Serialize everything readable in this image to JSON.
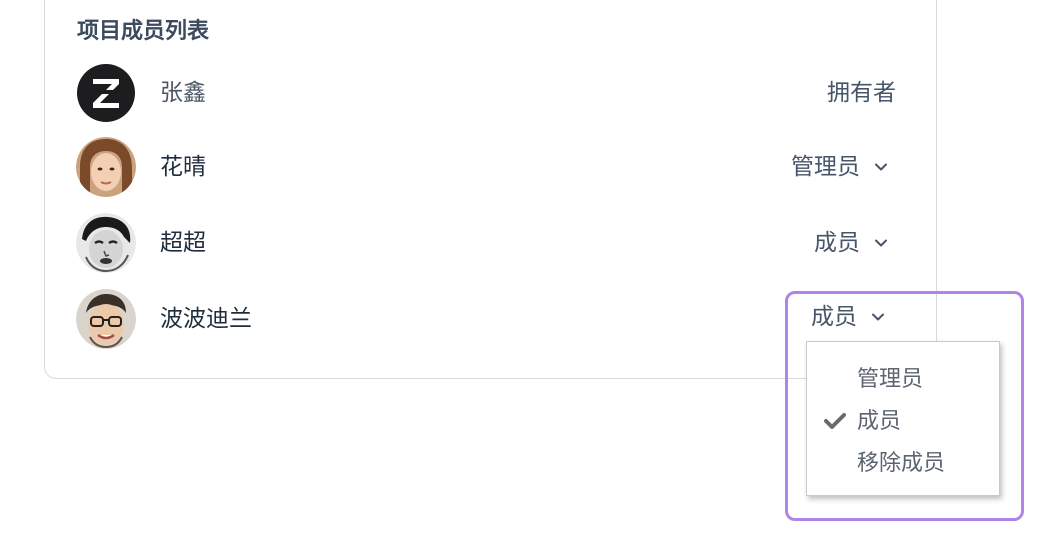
{
  "card": {
    "title": "项目成员列表"
  },
  "members": [
    {
      "name": "张鑫",
      "role": "拥有者",
      "editable": false,
      "avatar": "z-logo-avatar"
    },
    {
      "name": "花晴",
      "role": "管理员",
      "editable": true,
      "avatar": "photo-avatar-woman"
    },
    {
      "name": "超超",
      "role": "成员",
      "editable": true,
      "avatar": "photo-avatar-man-sketch"
    },
    {
      "name": "波波迪兰",
      "role": "成员",
      "editable": true,
      "avatar": "photo-avatar-man-glasses"
    }
  ],
  "role_menu": {
    "items": [
      {
        "label": "管理员",
        "checked": false
      },
      {
        "label": "成员",
        "checked": true
      },
      {
        "label": "移除成员",
        "checked": false
      }
    ]
  },
  "colors": {
    "highlight": "#b184e8",
    "title": "#3b4a5e",
    "text": "#1f2d3d",
    "muted": "#5b6470"
  },
  "icons": {
    "dropdown": "chevron-down-icon",
    "selected": "checkmark-icon"
  }
}
